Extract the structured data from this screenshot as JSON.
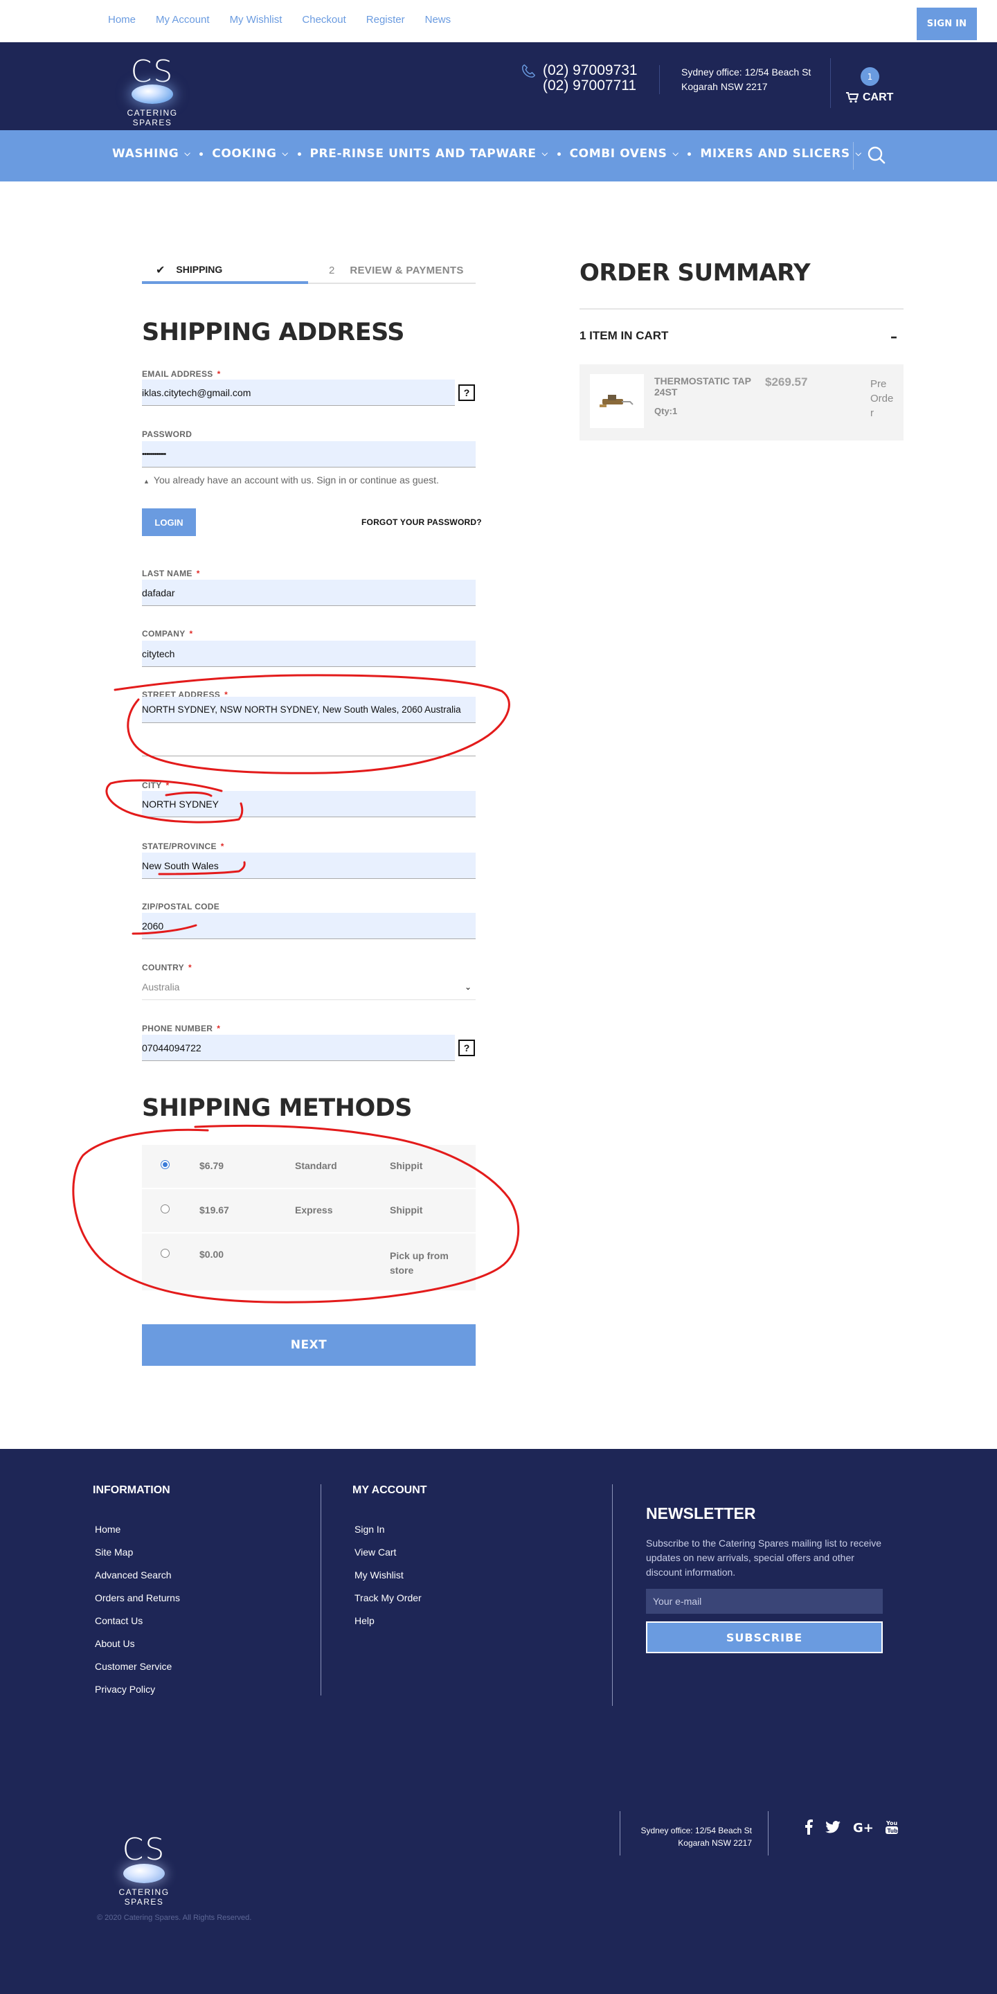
{
  "top_links": [
    "Home",
    "My Account",
    "My Wishlist",
    "Checkout",
    "Register",
    "News"
  ],
  "sign_in": "SIGN IN",
  "logo": {
    "mark": "CS",
    "name": "CATERING SPARES"
  },
  "header": {
    "phone_1": "(02) 97009731",
    "phone_2": "(02) 97007711",
    "office_1": "Sydney office: 12/54 Beach St",
    "office_2": "Kogarah NSW 2217",
    "cart_count": "1",
    "cart_label": "CART"
  },
  "nav": [
    "WASHING",
    "COOKING",
    "PRE-RINSE UNITS AND TAPWARE",
    "COMBI OVENS",
    "MIXERS AND SLICERS"
  ],
  "steps": {
    "step1_label": "SHIPPING",
    "step2_num": "2",
    "step2_label": "REVIEW & PAYMENTS"
  },
  "shipping_address": {
    "title": "SHIPPING ADDRESS",
    "email_label": "EMAIL ADDRESS",
    "email_value": "iklas.citytech@gmail.com",
    "password_label": "PASSWORD",
    "password_value": "••••••••••••",
    "account_note": "You already have an account with us. Sign in or continue as guest.",
    "login_button": "LOGIN",
    "forgot_link": "FORGOT YOUR PASSWORD?",
    "lastname_label": "LAST NAME",
    "lastname_value": "dafadar",
    "company_label": "COMPANY",
    "company_value": "citytech",
    "street_label": "STREET ADDRESS",
    "street_value": "NORTH SYDNEY, NSW NORTH SYDNEY, New South Wales, 2060 Australia",
    "street_value_2": "",
    "city_label": "CITY",
    "city_value": "NORTH SYDNEY",
    "state_label": "STATE/PROVINCE",
    "state_value": "New South Wales",
    "zip_label": "ZIP/POSTAL CODE",
    "zip_value": "2060",
    "country_label": "COUNTRY",
    "country_value": "Australia",
    "phone_label": "PHONE NUMBER",
    "phone_value": "07044094722",
    "help_mark": "?"
  },
  "shipping_methods": {
    "title": "SHIPPING METHODS",
    "rows": [
      {
        "price": "$6.79",
        "method": "Standard",
        "carrier": "Shippit",
        "selected": true
      },
      {
        "price": "$19.67",
        "method": "Express",
        "carrier": "Shippit",
        "selected": false
      },
      {
        "price": "$0.00",
        "method": "",
        "carrier": "Pick up from store",
        "selected": false
      }
    ]
  },
  "next_button": "NEXT",
  "order_summary": {
    "title": "ORDER SUMMARY",
    "items_count": "1 ITEM IN CART",
    "product_name": "THERMOSTATIC TAP 24ST",
    "product_price": "$269.57",
    "product_qty": "Qty:1",
    "product_status": "Pre Order"
  },
  "footer": {
    "info_title": "INFORMATION",
    "info_links": [
      "Home",
      "Site Map",
      "Advanced Search",
      "Orders and Returns",
      "Contact Us",
      "About Us",
      "Customer Service",
      "Privacy Policy"
    ],
    "account_title": "MY ACCOUNT",
    "account_links": [
      "Sign In",
      "View Cart",
      "My Wishlist",
      "Track My Order",
      "Help"
    ],
    "newsletter_title": "NEWSLETTER",
    "newsletter_text": "Subscribe to the Catering Spares mailing list to receive updates on new arrivals, special offers and other discount information.",
    "newsletter_placeholder": "Your e-mail",
    "subscribe_button": "SUBSCRIBE",
    "office_1": "Sydney office: 12/54 Beach St",
    "office_2": "Kogarah NSW 2217",
    "copyright": "© 2020 Catering Spares. All Rights Reserved."
  },
  "colors": {
    "navy": "#1e2656",
    "accent": "#6a9be0",
    "annotation": "#e31b1b"
  }
}
